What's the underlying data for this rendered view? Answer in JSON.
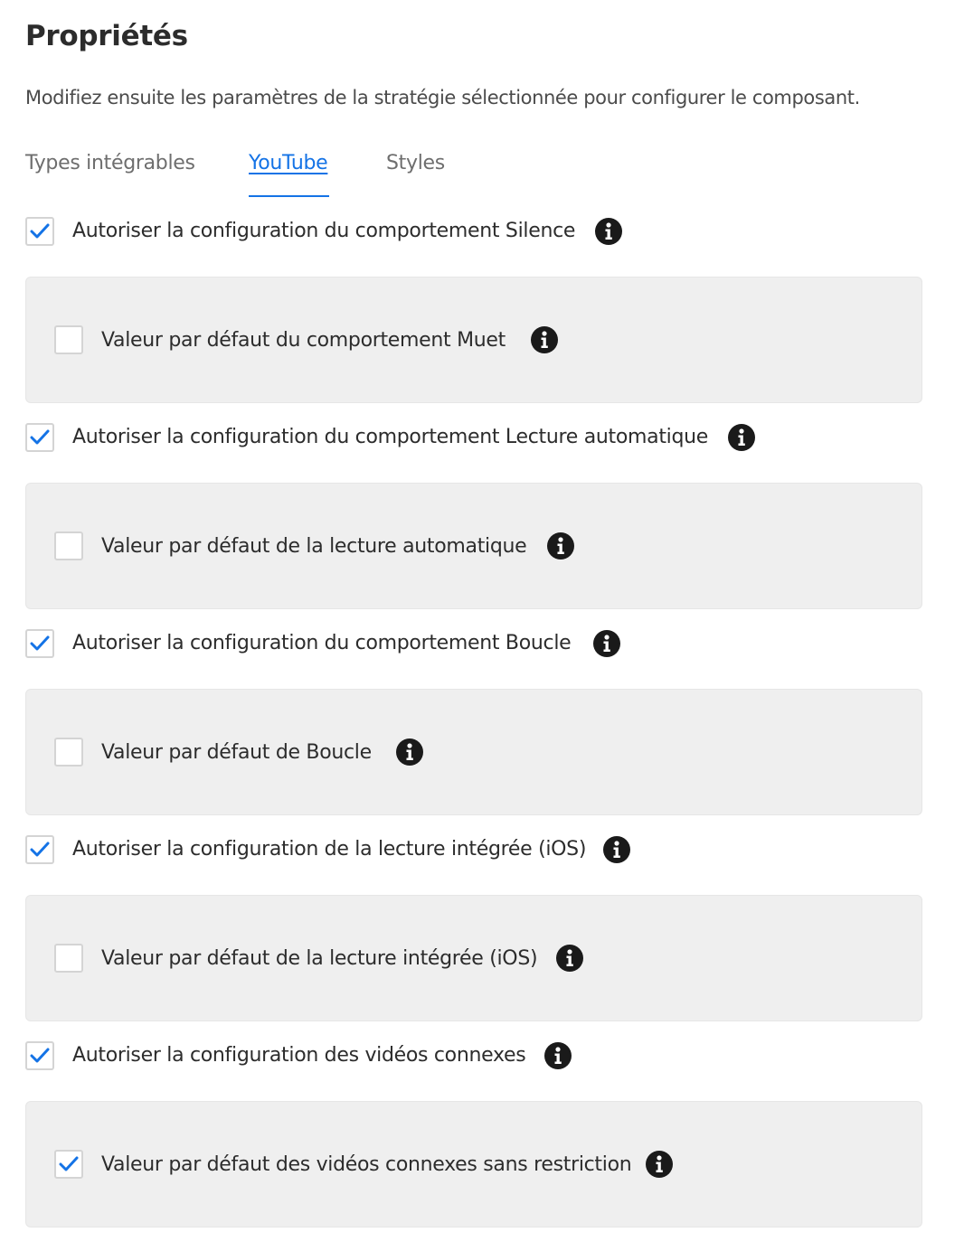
{
  "header": {
    "title": "Propriétés",
    "description": "Modifiez ensuite les paramètres de la stratégie sélectionnée pour configurer le composant."
  },
  "tabs": [
    {
      "label": "Types intégrables",
      "active": false
    },
    {
      "label": "YouTube",
      "active": true
    },
    {
      "label": "Styles",
      "active": false
    }
  ],
  "settings": [
    {
      "allow_label": "Autoriser la configuration du comportement Silence",
      "allow_checked": true,
      "default_label": "Valeur par défaut du comportement Muet",
      "default_checked": false
    },
    {
      "allow_label": "Autoriser la configuration du comportement Lecture automatique",
      "allow_checked": true,
      "default_label": "Valeur par défaut de la lecture automatique",
      "default_checked": false
    },
    {
      "allow_label": "Autoriser la configuration du comportement Boucle",
      "allow_checked": true,
      "default_label": "Valeur par défaut de Boucle",
      "default_checked": false
    },
    {
      "allow_label": "Autoriser la configuration de la lecture intégrée (iOS)",
      "allow_checked": true,
      "default_label": "Valeur par défaut de la lecture intégrée (iOS)",
      "default_checked": false
    },
    {
      "allow_label": "Autoriser la configuration des vidéos connexes",
      "allow_checked": true,
      "default_label": "Valeur par défaut des vidéos connexes sans restriction",
      "default_checked": true
    }
  ],
  "icons": {
    "checkmark": "checkmark-icon",
    "info": "info-icon"
  },
  "colors": {
    "accent": "#1473e6",
    "panel_bg": "#efefef",
    "text": "#2c2c2c",
    "info_icon": "#1a1a1a"
  }
}
